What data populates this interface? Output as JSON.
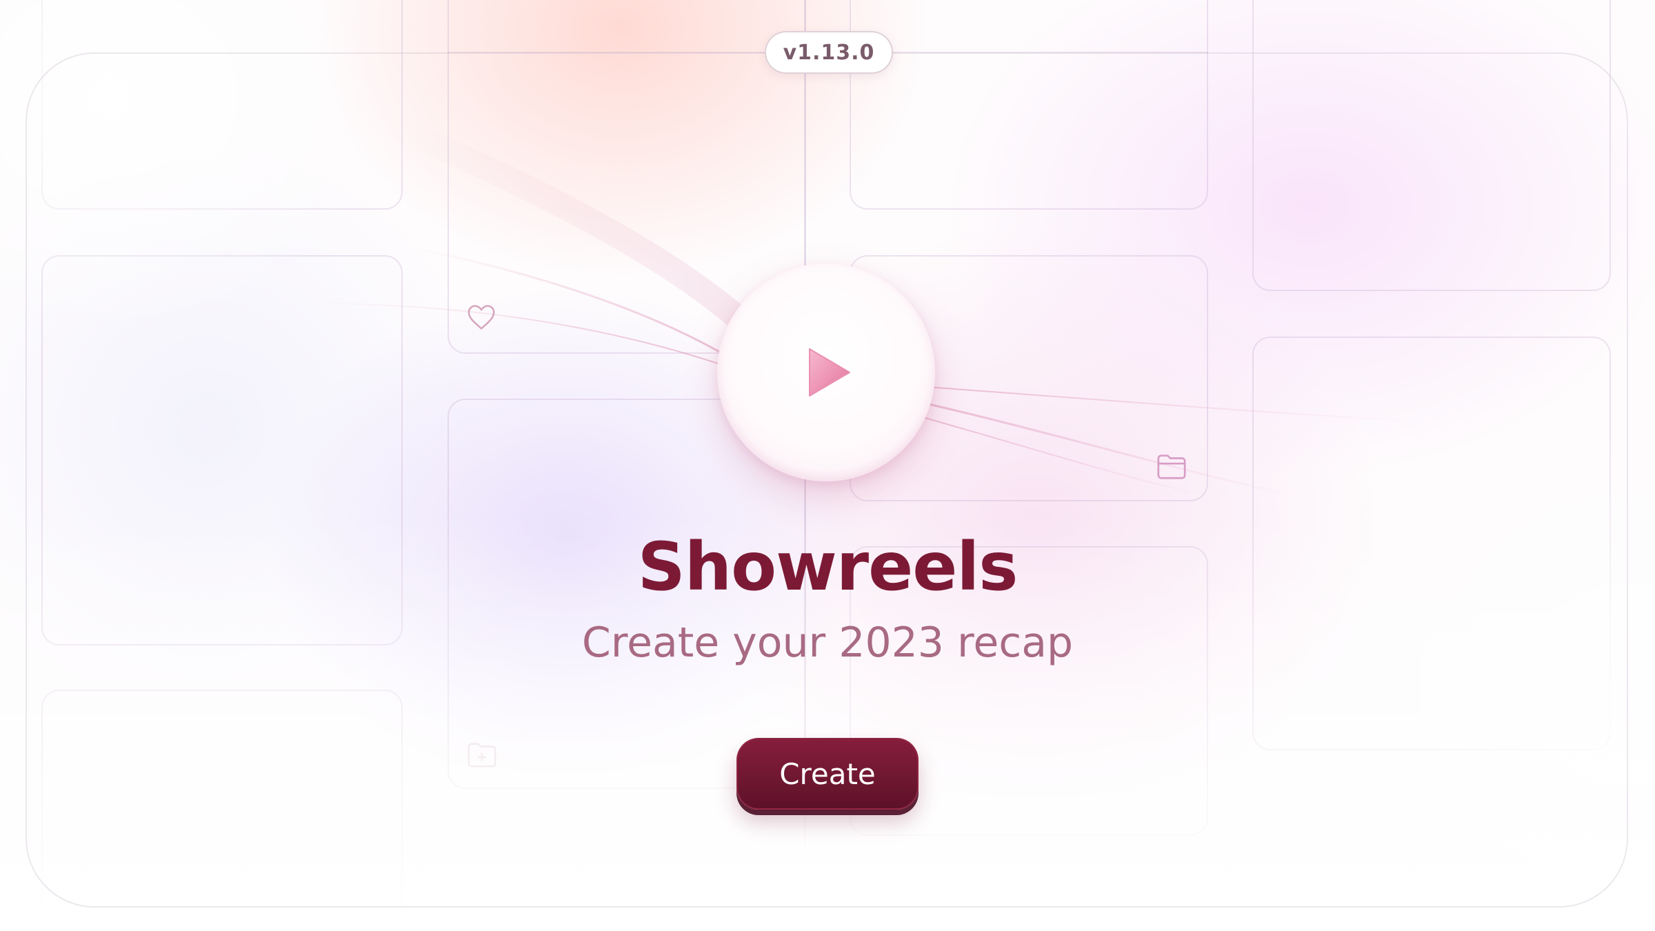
{
  "version_badge": {
    "label": "v1.13.0"
  },
  "hero": {
    "title": "Showreels",
    "subtitle": "Create your 2023 recap",
    "play_icon": "play-icon"
  },
  "actions": {
    "create_label": "Create"
  },
  "background_icons": [
    "heart-icon",
    "folder-icon",
    "folder-add-icon"
  ],
  "colors": {
    "accent": "#7c1a36",
    "subtitle": "#a86a82",
    "button": "#6e1731",
    "version_text": "#7a5b6a"
  }
}
